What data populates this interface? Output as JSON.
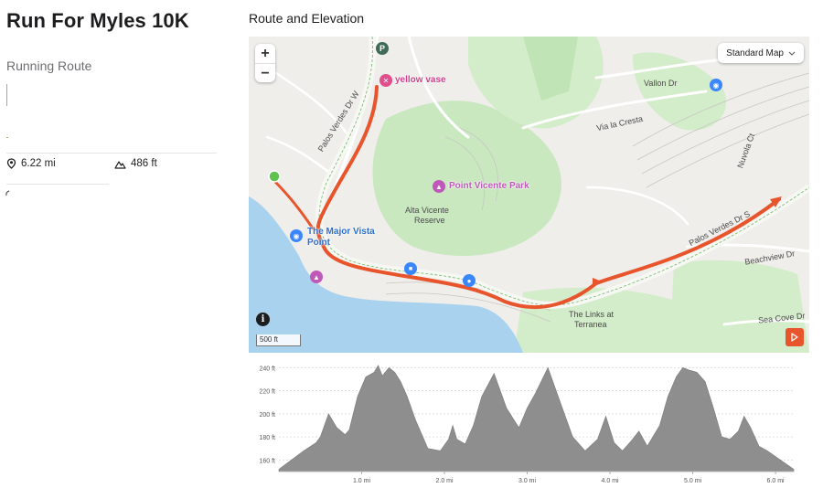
{
  "header": {
    "title": "Run For Myles 10K",
    "subtitle": "Running Route"
  },
  "stats": {
    "distance": "6.22 mi",
    "elevation_gain": "486 ft"
  },
  "map": {
    "heading": "Route and Elevation",
    "zoom_in": "+",
    "zoom_out": "−",
    "type_selector": "Standard Map",
    "scale": "500 ft",
    "info": "i",
    "labels": {
      "yellow_vase": "yellow vase",
      "vallon_dr": "Vallon Dr",
      "via_la_cresta": "Via la Cresta",
      "palos_verdes_w": "Palos Verdes Dr W",
      "nuvola_ct": "Nuvola Ct",
      "point_vicente_park": "Point Vicente Park",
      "alta_vicente_1": "Alta Vicente",
      "alta_vicente_2": "Reserve",
      "major_vista_1": "The Major Vista",
      "major_vista_2": "Point",
      "palos_verdes_s": "Palos Verdes Dr S",
      "beachview_dr": "Beachview Dr",
      "links_1": "The Links at",
      "links_2": "Terranea",
      "sea_cove_dr": "Sea Cove Dr"
    },
    "colors": {
      "route": "#e8542b",
      "water": "#a9d2ef",
      "park": "#c9e8c0",
      "land": "#efeeea"
    }
  },
  "elevation": {
    "y_ticks": [
      "240 ft",
      "220 ft",
      "200 ft",
      "180 ft",
      "160 ft"
    ],
    "x_ticks": [
      "1.0 mi",
      "2.0 mi",
      "3.0 mi",
      "4.0 mi",
      "5.0 mi",
      "6.0 mi"
    ]
  },
  "chart_data": {
    "type": "area",
    "xlabel": "",
    "ylabel": "",
    "xlim": [
      0,
      6.22
    ],
    "ylim": [
      150,
      245
    ],
    "x": [
      0,
      0.15,
      0.3,
      0.45,
      0.5,
      0.6,
      0.7,
      0.8,
      0.85,
      0.95,
      1.05,
      1.15,
      1.2,
      1.25,
      1.33,
      1.4,
      1.47,
      1.55,
      1.65,
      1.8,
      1.95,
      2.05,
      2.1,
      2.15,
      2.25,
      2.35,
      2.45,
      2.6,
      2.75,
      2.9,
      3.0,
      3.1,
      3.25,
      3.4,
      3.55,
      3.7,
      3.85,
      3.95,
      4.05,
      4.15,
      4.25,
      4.35,
      4.45,
      4.6,
      4.7,
      4.8,
      4.88,
      4.95,
      5.05,
      5.15,
      5.25,
      5.35,
      5.45,
      5.55,
      5.62,
      5.7,
      5.8,
      5.9,
      6.0,
      6.1,
      6.22
    ],
    "y": [
      152,
      160,
      168,
      175,
      180,
      200,
      188,
      182,
      186,
      215,
      232,
      236,
      242,
      233,
      240,
      236,
      228,
      215,
      195,
      170,
      168,
      178,
      190,
      178,
      174,
      190,
      215,
      235,
      205,
      188,
      205,
      218,
      240,
      210,
      180,
      168,
      178,
      198,
      175,
      168,
      176,
      185,
      172,
      190,
      215,
      232,
      240,
      238,
      236,
      228,
      205,
      180,
      178,
      185,
      198,
      188,
      172,
      168,
      163,
      158,
      152
    ]
  }
}
